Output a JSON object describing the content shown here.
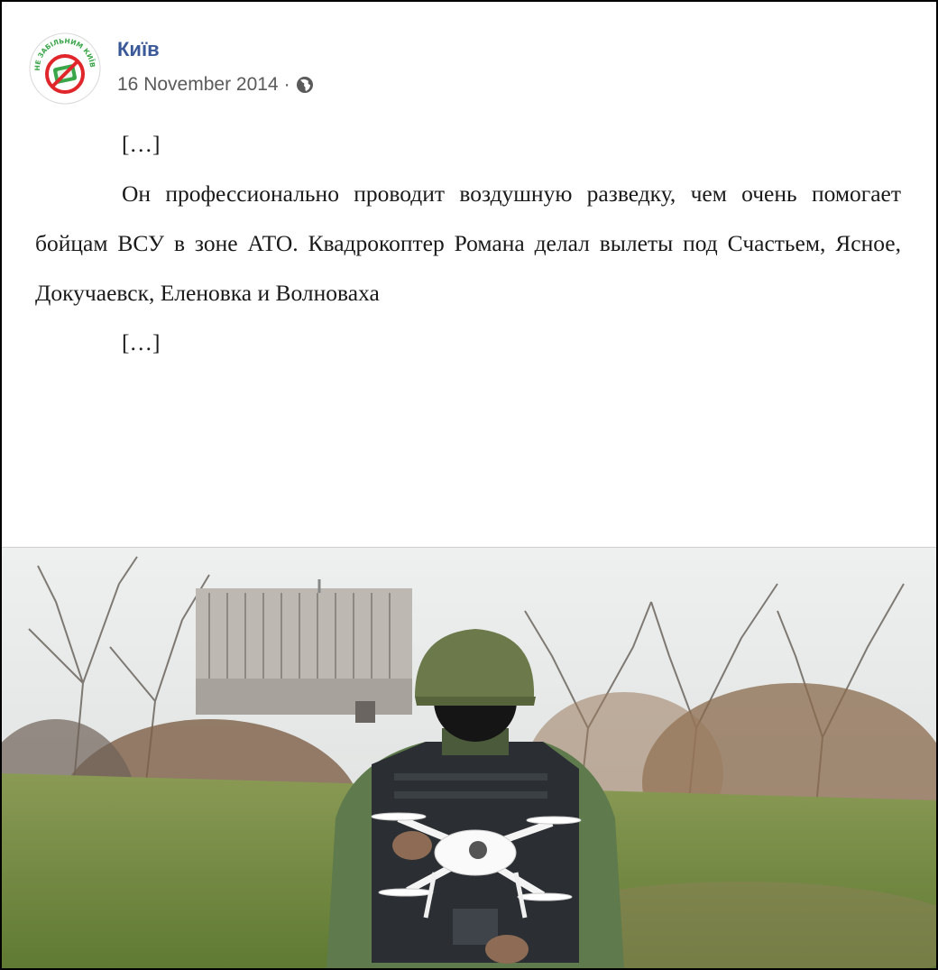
{
  "post": {
    "page_name": "Київ",
    "date": "16 November 2014",
    "separator": "·",
    "privacy_icon": "globe-icon",
    "avatar_icon": "no-entry-logo",
    "avatar_text": "НЕ ЗАБІЛЬНИМ КИЇВ!",
    "ellipsis_top": "[…]",
    "paragraph": "Он профессионально проводит воздушную разведку, чем очень помогает бойцам ВСУ в зоне АТО. Квадрокоптер Романа делал вылеты под Счастьем, Ясное, Докучаевск, Еленовка и Волноваха",
    "ellipsis_bottom": "[…]"
  },
  "photo": {
    "subject": "soldier-with-quadcopter-photo"
  },
  "colors": {
    "name_link": "#3b5998",
    "meta_text": "#5a5a5a",
    "logo_red": "#e0262a",
    "logo_green": "#3aa64a"
  }
}
